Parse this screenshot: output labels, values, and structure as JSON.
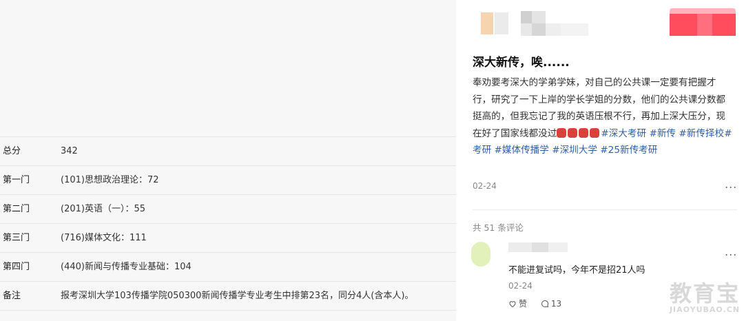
{
  "scores": [
    {
      "key": "总分",
      "value": "342"
    },
    {
      "key": "第一门",
      "value": "(101)思想政治理论：72"
    },
    {
      "key": "第二门",
      "value": "(201)英语（一）：55"
    },
    {
      "key": "第三门",
      "value": "(716)媒体文化：111"
    },
    {
      "key": "第四门",
      "value": "(440)新闻与传播专业基础：104"
    },
    {
      "key": "备注",
      "value": "报考深圳大学103传播学院050300新闻传播学专业考生中排第23名，同分4人(含本人)。"
    }
  ],
  "post": {
    "title": "深大新传，唉......",
    "body": "奉劝要考深大的学弟学妹，对自己的公共课一定要有把握才行，研究了一下上岸的学长学姐的分数，他们的公共课分数都挺高的，但我忘记了我的英语压根不行，再加上深大压分，现在好了国家线都没过",
    "emoji_count": 4,
    "tags": [
      "#深大考研",
      "#新传",
      "#新传择校",
      "#考研",
      "#媒体传播学",
      "#深圳大学",
      "#25新传考研"
    ],
    "date": "02-24",
    "more": "...",
    "comment_count": "共 51 条评论"
  },
  "comment": {
    "text": "不能进复试吗，今年不是招21人吗",
    "date": "02-24",
    "like_label": "赞",
    "reply_count": "13",
    "more": "..."
  },
  "watermark": {
    "cn": "教育宝",
    "en": "JIAOYUBAO.CN"
  },
  "colors": {
    "tag": "#2f5fa8",
    "emoji": "#d9423b",
    "blur_red": "#ff4d5e"
  }
}
